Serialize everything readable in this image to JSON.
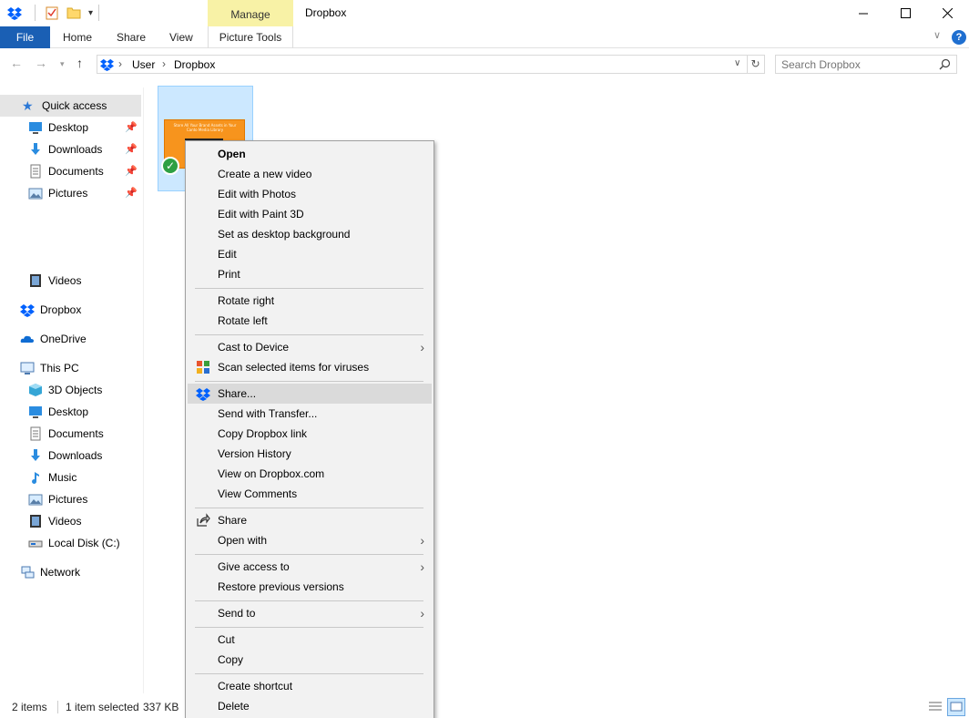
{
  "window": {
    "title": "Dropbox",
    "manage_tab": "Manage"
  },
  "ribbon": {
    "file": "File",
    "tabs": [
      "Home",
      "Share",
      "View"
    ],
    "picture_tools": "Picture Tools"
  },
  "address": {
    "path": [
      "User",
      "Dropbox"
    ],
    "search_placeholder": "Search Dropbox"
  },
  "nav": {
    "quick_access": "Quick access",
    "quick_items": [
      {
        "label": "Desktop",
        "icon": "desktop-icon"
      },
      {
        "label": "Downloads",
        "icon": "downloads-icon"
      },
      {
        "label": "Documents",
        "icon": "documents-icon"
      },
      {
        "label": "Pictures",
        "icon": "pictures-icon"
      }
    ],
    "videos": "Videos",
    "dropbox": "Dropbox",
    "onedrive": "OneDrive",
    "this_pc": "This PC",
    "pc_items": [
      {
        "label": "3D Objects",
        "icon": "3d-objects-icon"
      },
      {
        "label": "Desktop",
        "icon": "desktop-icon"
      },
      {
        "label": "Documents",
        "icon": "documents-icon"
      },
      {
        "label": "Downloads",
        "icon": "downloads-icon"
      },
      {
        "label": "Music",
        "icon": "music-icon"
      },
      {
        "label": "Pictures",
        "icon": "pictures-icon"
      },
      {
        "label": "Videos",
        "icon": "videos-icon"
      },
      {
        "label": "Local Disk (C:)",
        "icon": "local-disk-icon"
      }
    ],
    "network": "Network"
  },
  "thumbnail": {
    "text_line1": "Store All Your Brand Assets in Your",
    "text_line2": "Canto Media Library"
  },
  "context_menu": {
    "items": [
      {
        "label": "Open",
        "bold": true
      },
      {
        "label": "Create a new video"
      },
      {
        "label": "Edit with Photos"
      },
      {
        "label": "Edit with Paint 3D"
      },
      {
        "label": "Set as desktop background"
      },
      {
        "label": "Edit"
      },
      {
        "label": "Print"
      },
      {
        "label": "Rotate right"
      },
      {
        "label": "Rotate left"
      },
      {
        "label": "Cast to Device",
        "submenu": true
      },
      {
        "label": "Scan selected items for viruses",
        "icon": "antivirus-icon"
      },
      {
        "label": "Share...",
        "icon": "dropbox-icon",
        "highlighted": true
      },
      {
        "label": "Send with Transfer..."
      },
      {
        "label": "Copy Dropbox link"
      },
      {
        "label": "Version History"
      },
      {
        "label": "View on Dropbox.com"
      },
      {
        "label": "View Comments"
      },
      {
        "label": "Share",
        "icon": "share-icon"
      },
      {
        "label": "Open with",
        "submenu": true
      },
      {
        "label": "Give access to",
        "submenu": true
      },
      {
        "label": "Restore previous versions"
      },
      {
        "label": "Send to",
        "submenu": true
      },
      {
        "label": "Cut"
      },
      {
        "label": "Copy"
      },
      {
        "label": "Create shortcut"
      },
      {
        "label": "Delete"
      }
    ]
  },
  "status": {
    "item_count": "2 items",
    "selected": "1 item selected",
    "size": "337 KB"
  },
  "colors": {
    "file_tab": "#1a5fb4",
    "manage_tab": "#f8f2a6",
    "selection": "#cce8ff",
    "dropbox_blue": "#0061fe"
  }
}
